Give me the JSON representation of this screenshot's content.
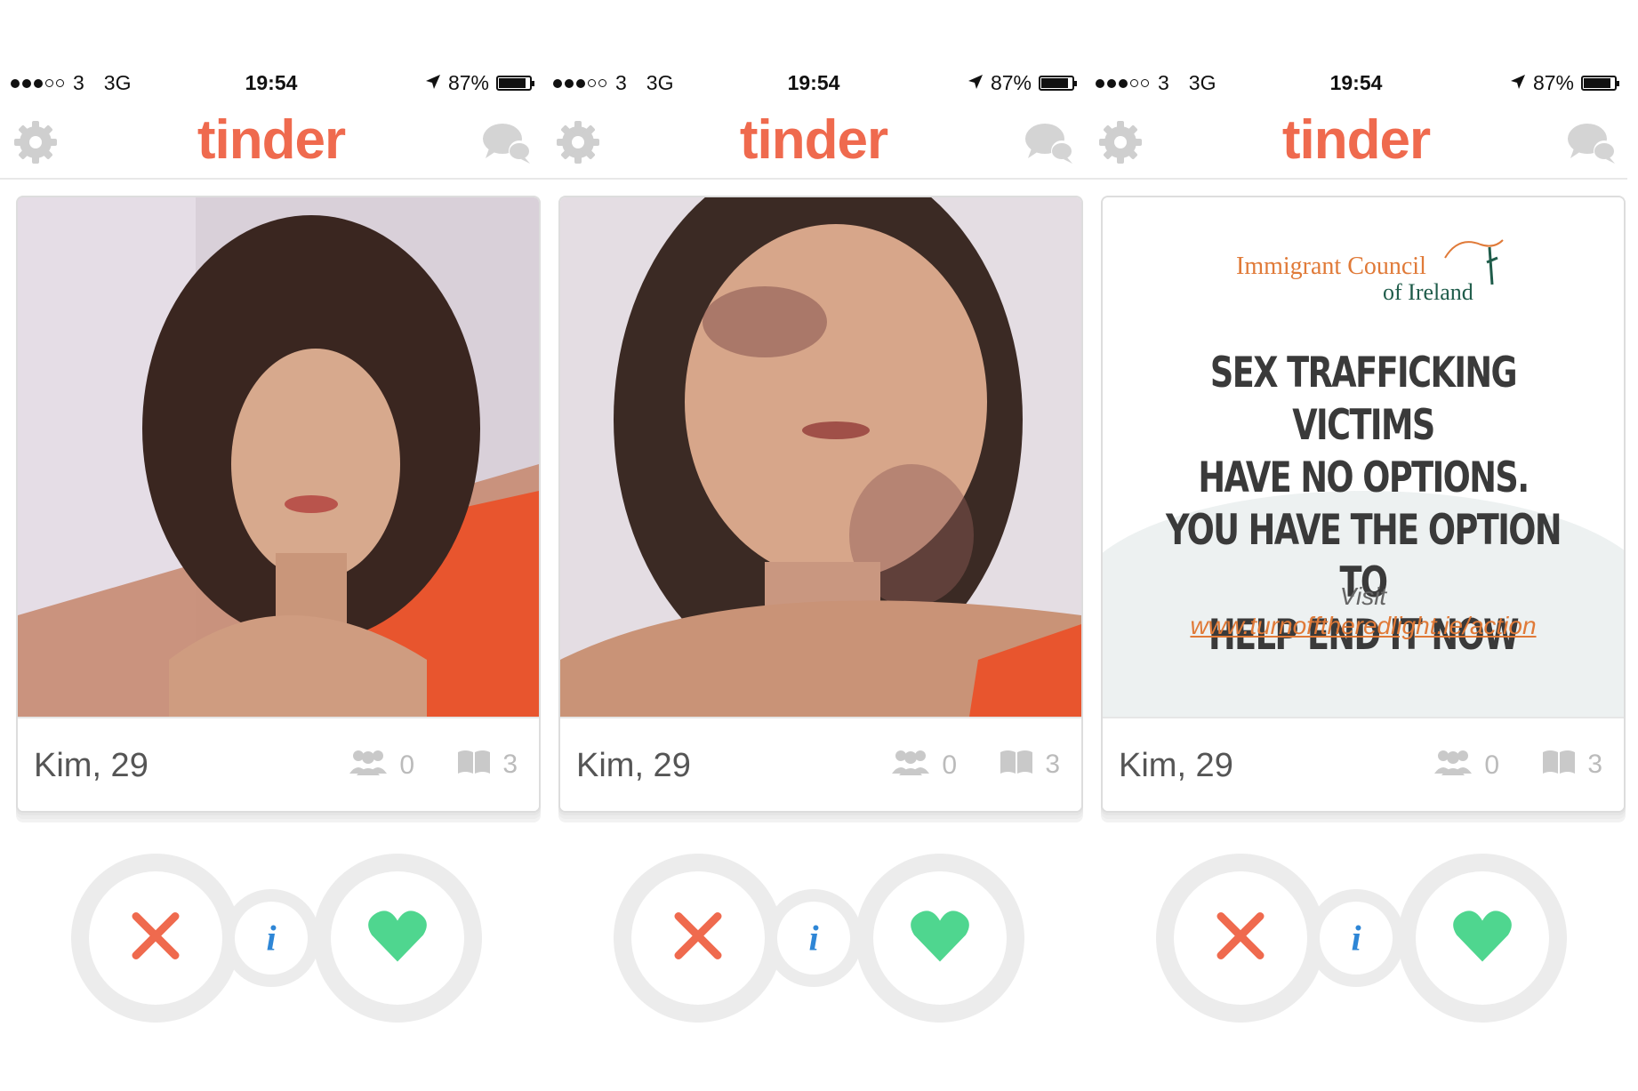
{
  "brand_color": "#ef6a4e",
  "screens": [
    {
      "status": {
        "carrier": "3",
        "network": "3G",
        "time": "19:54",
        "battery": "87%"
      },
      "logo": "tinder",
      "card": {
        "name": "Kim, 29",
        "friends_count": "0",
        "interests_count": "3"
      },
      "actions": {
        "nope": "nope-icon",
        "info": "i",
        "like": "heart-icon"
      }
    },
    {
      "status": {
        "carrier": "3",
        "network": "3G",
        "time": "19:54",
        "battery": "87%"
      },
      "logo": "tinder",
      "card": {
        "name": "Kim, 29",
        "friends_count": "0",
        "interests_count": "3"
      },
      "actions": {
        "nope": "nope-icon",
        "info": "i",
        "like": "heart-icon"
      }
    },
    {
      "status": {
        "carrier": "3",
        "network": "3G",
        "time": "19:54",
        "battery": "87%"
      },
      "logo": "tinder",
      "card": {
        "name": "Kim, 29",
        "friends_count": "0",
        "interests_count": "3"
      },
      "ad": {
        "org_line1": "Immigrant Council",
        "org_line2": "of Ireland",
        "headline_lines": [
          "SEX TRAFFICKING VICTIMS",
          "HAVE NO OPTIONS.",
          "YOU HAVE THE OPTION TO",
          "HELP END IT NOW"
        ],
        "visit": "Visit",
        "url": "www.turnofftheredlight.ie/action"
      },
      "actions": {
        "nope": "nope-icon",
        "info": "i",
        "like": "heart-icon"
      }
    }
  ]
}
